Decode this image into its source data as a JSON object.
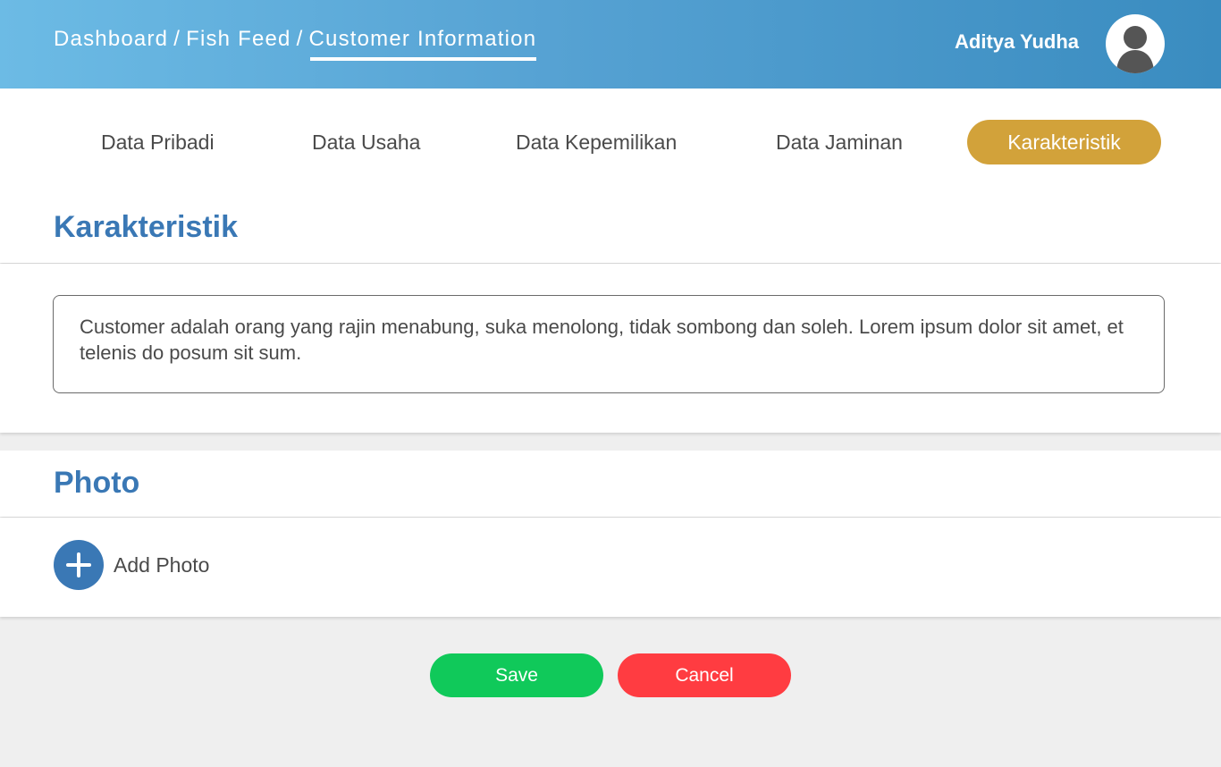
{
  "header": {
    "breadcrumb": [
      "Dashboard",
      "Fish Feed",
      "Customer Information"
    ],
    "separator": "/",
    "user_name": "Aditya Yudha",
    "avatar_icon": "user-avatar-icon"
  },
  "tabs": [
    {
      "label": "Data Pribadi",
      "active": false
    },
    {
      "label": "Data Usaha",
      "active": false
    },
    {
      "label": "Data Kepemilikan",
      "active": false
    },
    {
      "label": "Data Jaminan",
      "active": false
    },
    {
      "label": "Karakteristik",
      "active": true
    }
  ],
  "karakteristik": {
    "title": "Karakteristik",
    "text": "Customer adalah orang yang rajin menabung, suka menolong, tidak sombong dan soleh. Lorem ipsum dolor sit amet, et telenis do posum sit sum."
  },
  "photo": {
    "title": "Photo",
    "add_label": "Add Photo",
    "add_icon": "plus-circle-icon"
  },
  "actions": {
    "save_label": "Save",
    "cancel_label": "Cancel"
  },
  "colors": {
    "header_gradient_start": "#6cbbe5",
    "header_gradient_end": "#3a8cc0",
    "accent_blue": "#3a78b5",
    "active_tab": "#d2a23a",
    "save": "#10c95a",
    "cancel": "#ff3c41",
    "background": "#efefef"
  }
}
